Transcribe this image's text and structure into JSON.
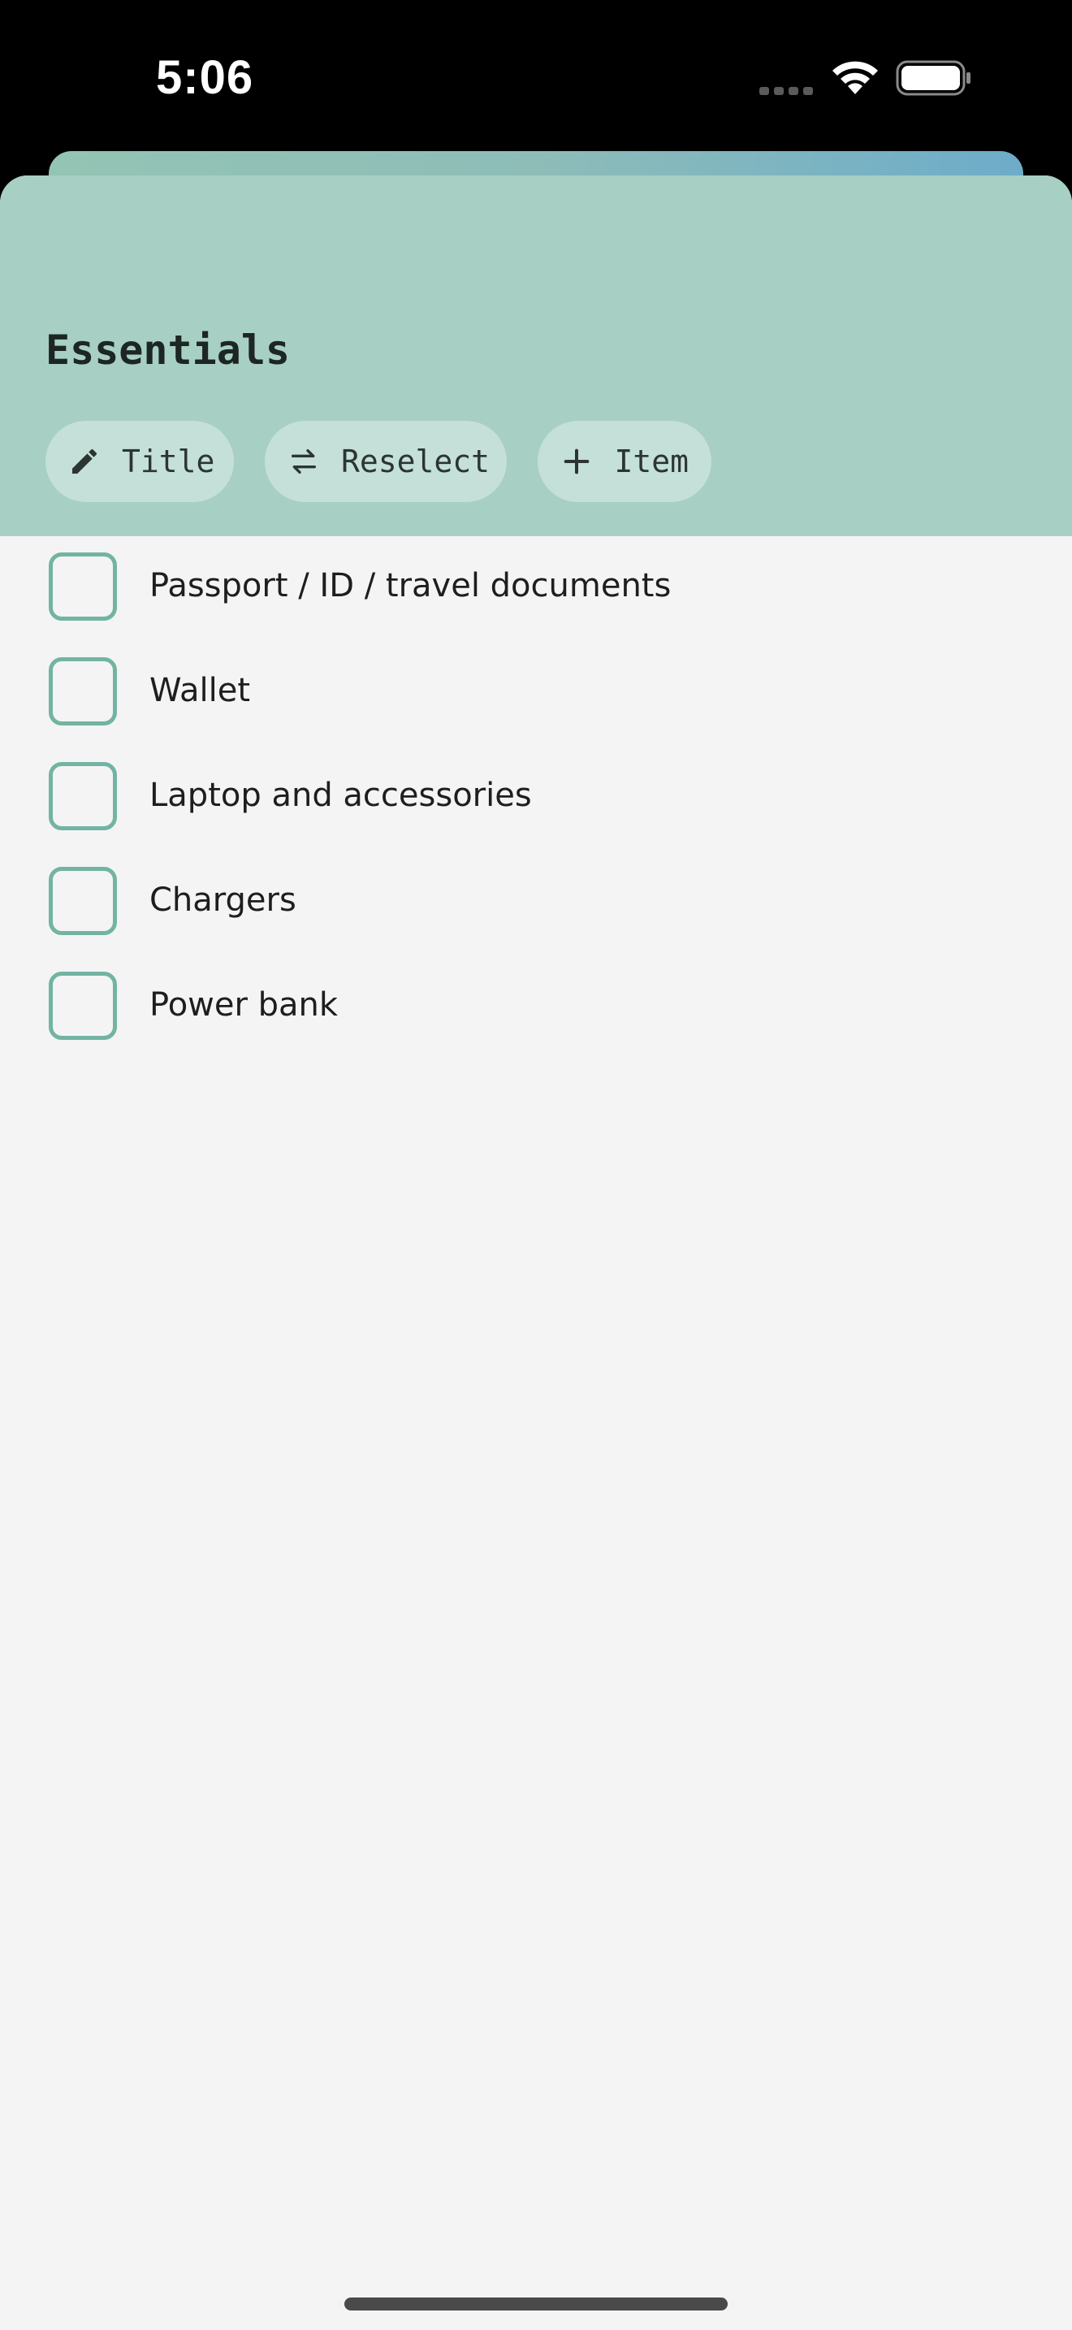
{
  "status_bar": {
    "time": "5:06"
  },
  "sheet": {
    "title": "Essentials",
    "header_color": "#a8cfc4",
    "accent_color": "#72b4a2",
    "actions": [
      {
        "icon": "pencil-icon",
        "label": "Title"
      },
      {
        "icon": "swap-arrows-icon",
        "label": "Reselect"
      },
      {
        "icon": "plus-icon",
        "label": "Item"
      }
    ]
  },
  "checklist": {
    "items": [
      {
        "label": "Passport / ID / travel documents",
        "checked": false
      },
      {
        "label": "Wallet",
        "checked": false
      },
      {
        "label": "Laptop and accessories",
        "checked": false
      },
      {
        "label": "Chargers",
        "checked": false
      },
      {
        "label": "Power bank",
        "checked": false
      }
    ]
  }
}
